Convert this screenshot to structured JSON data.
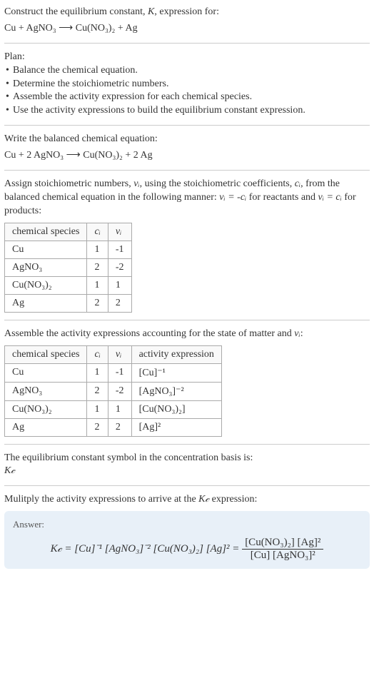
{
  "prompt": {
    "title": "Construct the equilibrium constant, K, expression for:",
    "equation": "Cu + AgNO₃  ⟶  Cu(NO₃)₂ + Ag"
  },
  "plan": {
    "heading": "Plan:",
    "items": [
      "Balance the chemical equation.",
      "Determine the stoichiometric numbers.",
      "Assemble the activity expression for each chemical species.",
      "Use the activity expressions to build the equilibrium constant expression."
    ]
  },
  "balanced": {
    "heading": "Write the balanced chemical equation:",
    "equation": "Cu + 2 AgNO₃  ⟶  Cu(NO₃)₂ + 2 Ag"
  },
  "stoich": {
    "heading_prefix": "Assign stoichiometric numbers, ",
    "nu": "νᵢ",
    "heading_mid1": ", using the stoichiometric coefficients, ",
    "ci": "cᵢ",
    "heading_mid2": ", from the balanced chemical equation in the following manner: ",
    "rel_react": "νᵢ = -cᵢ",
    "heading_mid3": " for reactants and ",
    "rel_prod": "νᵢ = cᵢ",
    "heading_end": " for products:",
    "col1": "chemical species",
    "col2": "cᵢ",
    "col3": "νᵢ",
    "rows": [
      {
        "species": "Cu",
        "c": "1",
        "nu": "-1"
      },
      {
        "species": "AgNO₃",
        "c": "2",
        "nu": "-2"
      },
      {
        "species": "Cu(NO₃)₂",
        "c": "1",
        "nu": "1"
      },
      {
        "species": "Ag",
        "c": "2",
        "nu": "2"
      }
    ]
  },
  "activity": {
    "heading_prefix": "Assemble the activity expressions accounting for the state of matter and ",
    "nu": "νᵢ",
    "heading_end": ":",
    "col1": "chemical species",
    "col2": "cᵢ",
    "col3": "νᵢ",
    "col4": "activity expression",
    "rows": [
      {
        "species": "Cu",
        "c": "1",
        "nu": "-1",
        "expr": "[Cu]⁻¹"
      },
      {
        "species": "AgNO₃",
        "c": "2",
        "nu": "-2",
        "expr": "[AgNO₃]⁻²"
      },
      {
        "species": "Cu(NO₃)₂",
        "c": "1",
        "nu": "1",
        "expr": "[Cu(NO₃)₂]"
      },
      {
        "species": "Ag",
        "c": "2",
        "nu": "2",
        "expr": "[Ag]²"
      }
    ]
  },
  "kc_symbol": {
    "heading": "The equilibrium constant symbol in the concentration basis is:",
    "symbol": "K𝒸"
  },
  "multiply": {
    "heading_prefix": "Mulitply the activity expressions to arrive at the ",
    "kc": "K𝒸",
    "heading_end": " expression:"
  },
  "answer": {
    "label": "Answer:",
    "lhs": "K𝒸 = [Cu]⁻¹ [AgNO₃]⁻² [Cu(NO₃)₂] [Ag]² = ",
    "num": "[Cu(NO₃)₂] [Ag]²",
    "den": "[Cu] [AgNO₃]²"
  }
}
